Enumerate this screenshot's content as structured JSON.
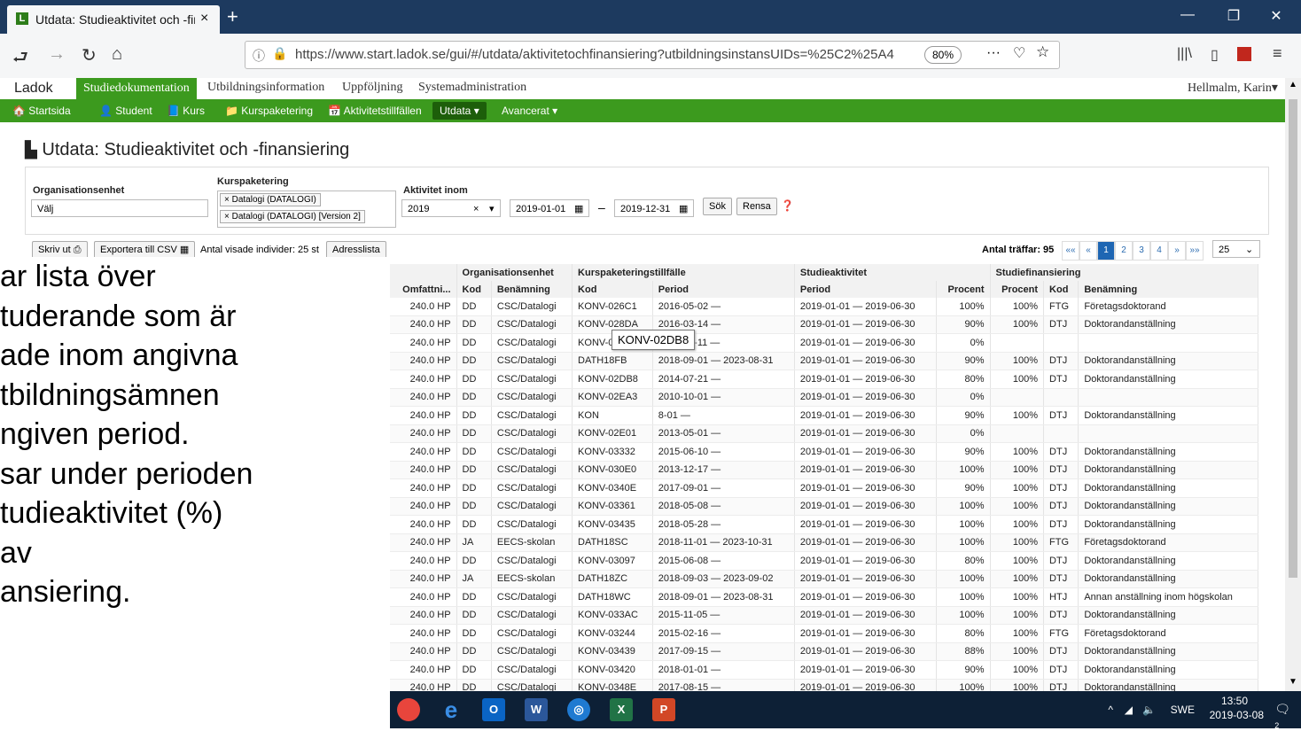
{
  "browser": {
    "tab_title": "Utdata: Studieaktivitet och -fina",
    "tab_close": "×",
    "new_tab": "+",
    "url": "https://www.start.ladok.se/gui/#/utdata/aktivitetochfinansiering?utbildningsinstansUIDs=%25C2%25A4",
    "zoom": "80%",
    "menu_dots": "···"
  },
  "ladok": {
    "logo": "Ladok",
    "nav": [
      "Studiedokumentation",
      "Utbildningsinformation",
      "Uppföljning",
      "Systemadministration"
    ],
    "user": "Hellmalm, Karin",
    "subnav": [
      "Startsida",
      "Student",
      "Kurs",
      "Kurspaketering",
      "Aktivitetstillfällen",
      "Utdata",
      "Avancerat"
    ]
  },
  "page": {
    "title": "Utdata: Studieaktivitet och -finansiering"
  },
  "filters": {
    "org_label": "Organisationsenhet",
    "org_value": "Välj",
    "kurspak_label": "Kurspaketering",
    "kurspak_chips": [
      "× Datalogi (DATALOGI)",
      "× Datalogi (DATALOGI) [Version 2]"
    ],
    "aktivitet_label": "Aktivitet inom",
    "year": "2019",
    "date_from": "2019-01-01",
    "date_sep": "–",
    "date_to": "2019-12-31",
    "search_btn": "Sök",
    "clear_btn": "Rensa"
  },
  "toolbar": {
    "print": "Skriv ut",
    "export": "Exportera till CSV",
    "count_text": "Antal visade individer: 25 st",
    "address_btn": "Adresslista",
    "hits_text": "Antal träffar: 95",
    "pages": [
      "««",
      "«",
      "1",
      "2",
      "3",
      "4",
      "»",
      "»»"
    ],
    "page_size": "25"
  },
  "table": {
    "group_headers": [
      "Organisationsenhet",
      "Kurspaketeringstillfälle",
      "Studieaktivitet",
      "Studiefinansiering"
    ],
    "headers": [
      "Omfattni...",
      "Kod",
      "Benämning",
      "Kod",
      "Period",
      "Period",
      "Procent",
      "Procent",
      "Kod",
      "Benämning"
    ],
    "rows": [
      [
        "240.0 HP",
        "DD",
        "CSC/Datalogi",
        "KONV-026C1",
        "2016-05-02 —",
        "2019-01-01 — 2019-06-30",
        "100%",
        "100%",
        "FTG",
        "Företagsdoktorand"
      ],
      [
        "240.0 HP",
        "DD",
        "CSC/Datalogi",
        "KONV-028DA",
        "2016-03-14 —",
        "2019-01-01 — 2019-06-30",
        "90%",
        "100%",
        "DTJ",
        "Doktorandanställning"
      ],
      [
        "240.0 HP",
        "DD",
        "CSC/Datalogi",
        "KONV-02E8B",
        "2017-05-11 —",
        "2019-01-01 — 2019-06-30",
        "0%",
        "",
        "",
        ""
      ],
      [
        "240.0 HP",
        "DD",
        "CSC/Datalogi",
        "DATH18FB",
        "2018-09-01 — 2023-08-31",
        "2019-01-01 — 2019-06-30",
        "90%",
        "100%",
        "DTJ",
        "Doktorandanställning"
      ],
      [
        "240.0 HP",
        "DD",
        "CSC/Datalogi",
        "KONV-02DB8",
        "2014-07-21 —",
        "2019-01-01 — 2019-06-30",
        "80%",
        "100%",
        "DTJ",
        "Doktorandanställning"
      ],
      [
        "240.0 HP",
        "DD",
        "CSC/Datalogi",
        "KONV-02EA3",
        "2010-10-01 —",
        "2019-01-01 — 2019-06-30",
        "0%",
        "",
        "",
        ""
      ],
      [
        "240.0 HP",
        "DD",
        "CSC/Datalogi",
        "KON",
        "8-01 —",
        "2019-01-01 — 2019-06-30",
        "90%",
        "100%",
        "DTJ",
        "Doktorandanställning"
      ],
      [
        "240.0 HP",
        "DD",
        "CSC/Datalogi",
        "KONV-02E01",
        "2013-05-01 —",
        "2019-01-01 — 2019-06-30",
        "0%",
        "",
        "",
        ""
      ],
      [
        "240.0 HP",
        "DD",
        "CSC/Datalogi",
        "KONV-03332",
        "2015-06-10 —",
        "2019-01-01 — 2019-06-30",
        "90%",
        "100%",
        "DTJ",
        "Doktorandanställning"
      ],
      [
        "240.0 HP",
        "DD",
        "CSC/Datalogi",
        "KONV-030E0",
        "2013-12-17 —",
        "2019-01-01 — 2019-06-30",
        "100%",
        "100%",
        "DTJ",
        "Doktorandanställning"
      ],
      [
        "240.0 HP",
        "DD",
        "CSC/Datalogi",
        "KONV-0340E",
        "2017-09-01 —",
        "2019-01-01 — 2019-06-30",
        "90%",
        "100%",
        "DTJ",
        "Doktorandanställning"
      ],
      [
        "240.0 HP",
        "DD",
        "CSC/Datalogi",
        "KONV-03361",
        "2018-05-08 —",
        "2019-01-01 — 2019-06-30",
        "100%",
        "100%",
        "DTJ",
        "Doktorandanställning"
      ],
      [
        "240.0 HP",
        "DD",
        "CSC/Datalogi",
        "KONV-03435",
        "2018-05-28 —",
        "2019-01-01 — 2019-06-30",
        "100%",
        "100%",
        "DTJ",
        "Doktorandanställning"
      ],
      [
        "240.0 HP",
        "JA",
        "EECS-skolan",
        "DATH18SC",
        "2018-11-01 — 2023-10-31",
        "2019-01-01 — 2019-06-30",
        "100%",
        "100%",
        "FTG",
        "Företagsdoktorand"
      ],
      [
        "240.0 HP",
        "DD",
        "CSC/Datalogi",
        "KONV-03097",
        "2015-06-08 —",
        "2019-01-01 — 2019-06-30",
        "80%",
        "100%",
        "DTJ",
        "Doktorandanställning"
      ],
      [
        "240.0 HP",
        "JA",
        "EECS-skolan",
        "DATH18ZC",
        "2018-09-03 — 2023-09-02",
        "2019-01-01 — 2019-06-30",
        "100%",
        "100%",
        "DTJ",
        "Doktorandanställning"
      ],
      [
        "240.0 HP",
        "DD",
        "CSC/Datalogi",
        "DATH18WC",
        "2018-09-01 — 2023-08-31",
        "2019-01-01 — 2019-06-30",
        "100%",
        "100%",
        "HTJ",
        "Annan anställning inom högskolan"
      ],
      [
        "240.0 HP",
        "DD",
        "CSC/Datalogi",
        "KONV-033AC",
        "2015-11-05 —",
        "2019-01-01 — 2019-06-30",
        "100%",
        "100%",
        "DTJ",
        "Doktorandanställning"
      ],
      [
        "240.0 HP",
        "DD",
        "CSC/Datalogi",
        "KONV-03244",
        "2015-02-16 —",
        "2019-01-01 — 2019-06-30",
        "80%",
        "100%",
        "FTG",
        "Företagsdoktorand"
      ],
      [
        "240.0 HP",
        "DD",
        "CSC/Datalogi",
        "KONV-03439",
        "2017-09-15 —",
        "2019-01-01 — 2019-06-30",
        "88%",
        "100%",
        "DTJ",
        "Doktorandanställning"
      ],
      [
        "240.0 HP",
        "DD",
        "CSC/Datalogi",
        "KONV-03420",
        "2018-01-01 —",
        "2019-01-01 — 2019-06-30",
        "90%",
        "100%",
        "DTJ",
        "Doktorandanställning"
      ],
      [
        "240.0 HP",
        "DD",
        "CSC/Datalogi",
        "KONV-0348E",
        "2017-08-15 —",
        "2019-01-01 — 2019-06-30",
        "100%",
        "100%",
        "DTJ",
        "Doktorandanställning"
      ]
    ]
  },
  "tooltip": "KONV-02DB8",
  "slide_text": [
    "ar lista över",
    "tuderande som är",
    "ade inom angivna",
    "tbildningsämnen",
    "ngiven period.",
    "sar under perioden",
    "tudieaktivitet (%)",
    "av",
    "ansiering."
  ],
  "taskbar": {
    "time": "13:50",
    "date": "2019-03-08",
    "lang": "SWE",
    "notifications": "2"
  }
}
